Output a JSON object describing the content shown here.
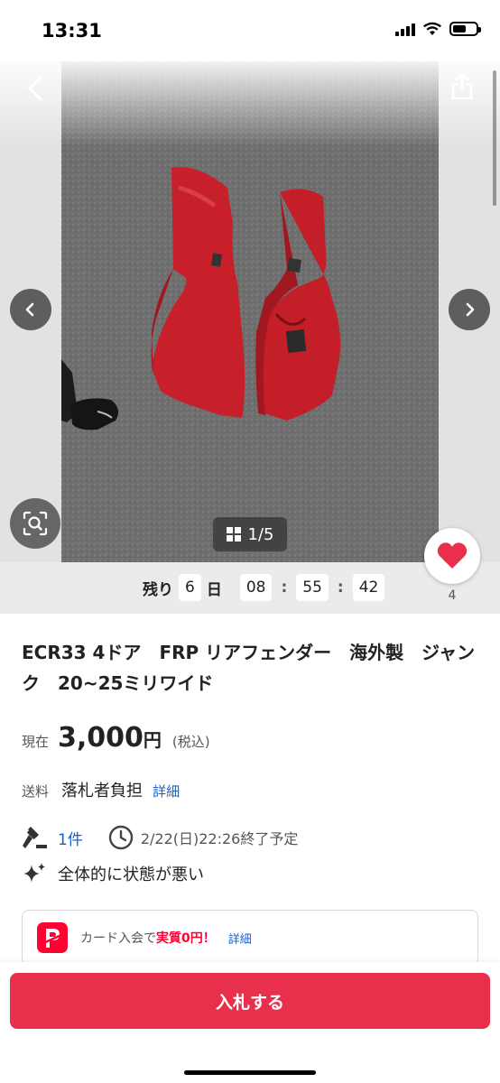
{
  "status_bar": {
    "time": "13:31",
    "battery_level": 0.6,
    "icons": [
      "signal-icon",
      "wifi-icon",
      "battery-icon"
    ]
  },
  "gallery": {
    "counter_text": "1/5",
    "icons": [
      "back-icon",
      "share-icon",
      "chevron-left-icon",
      "chevron-right-icon",
      "image-search-icon",
      "grid-icon"
    ]
  },
  "timer": {
    "label_remaining": "残り",
    "days": "6",
    "days_unit": "日",
    "hours": "08",
    "minutes": "55",
    "seconds": "42",
    "separator": ":"
  },
  "watch": {
    "count": "4",
    "icon": "heart-icon",
    "color": "#e8304d"
  },
  "item": {
    "title": "ECR33 4ドア　FRP リアフェンダー　海外製　ジャンク　20~25ミリワイド",
    "price_label": "現在",
    "price_value": "3,000",
    "price_unit": "円",
    "price_tax": "(税込)",
    "shipping_label": "送料",
    "shipping_value": "落札者負担",
    "shipping_link": "詳細",
    "bid_count": "1件",
    "end_time": "2/22(日)22:26終了予定",
    "condition": "全体的に状態が悪い"
  },
  "promo": {
    "text_prefix": "カード入会で",
    "text_strong": "実質0円！",
    "link": "詳細",
    "brand_color": "#ff0033"
  },
  "footer": {
    "bid_button": "入札する",
    "button_color": "#e8304d"
  }
}
